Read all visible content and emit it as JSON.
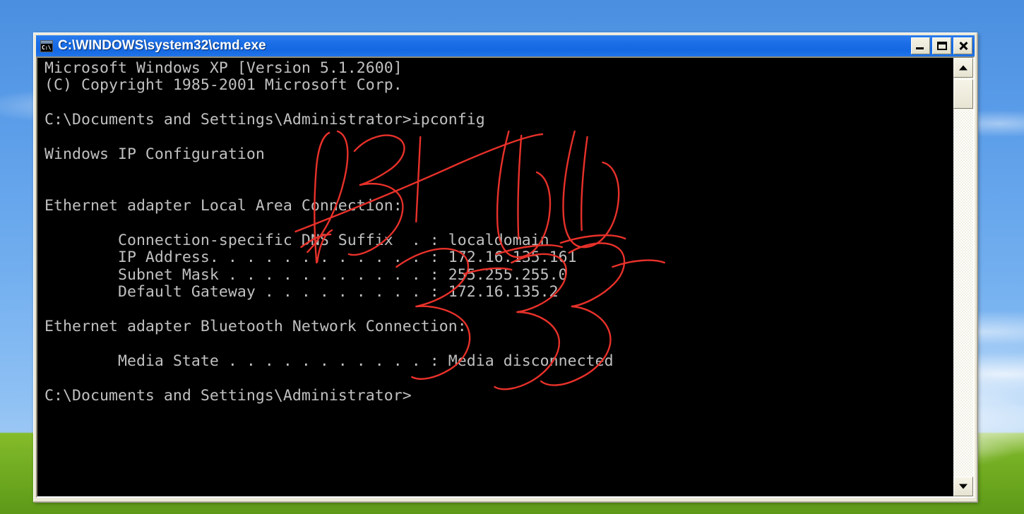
{
  "desktop": {
    "wallpaper_name": "bliss-wallpaper",
    "sky_color": "#5a9ce8",
    "grass_color": "#7cb527"
  },
  "window": {
    "title": "C:\\WINDOWS\\system32\\cmd.exe",
    "icon_name": "cmd-icon",
    "icon_glyph": "C:\\",
    "titlebar_color": "#1b6ee6",
    "buttons": {
      "minimize_label": "Minimize",
      "maximize_label": "Maximize",
      "close_label": "Close"
    }
  },
  "console": {
    "background_color": "#000000",
    "text_color": "#c0c0c0",
    "lines": [
      "Microsoft Windows XP [Version 5.1.2600]",
      "(C) Copyright 1985-2001 Microsoft Corp.",
      "",
      "C:\\Documents and Settings\\Administrator>ipconfig",
      "",
      "Windows IP Configuration",
      "",
      "",
      "Ethernet adapter Local Area Connection:",
      "",
      "        Connection-specific DNS Suffix  . : localdomain",
      "        IP Address. . . . . . . . . . . . : 172.16.135.161",
      "        Subnet Mask . . . . . . . . . . . : 255.255.255.0",
      "        Default Gateway . . . . . . . . . : 172.16.135.2",
      "",
      "Ethernet adapter Bluetooth Network Connection:",
      "",
      "        Media State . . . . . . . . . . . : Media disconnected",
      "",
      "C:\\Documents and Settings\\Administrator>"
    ],
    "command": "ipconfig",
    "prompt": "C:\\Documents and Settings\\Administrator>",
    "network": {
      "os_banner": "Microsoft Windows XP [Version 5.1.2600]",
      "copyright": "(C) Copyright 1985-2001 Microsoft Corp.",
      "section_title": "Windows IP Configuration",
      "adapters": [
        {
          "name": "Ethernet adapter Local Area Connection:",
          "fields": [
            {
              "label": "Connection-specific DNS Suffix",
              "value": "localdomain"
            },
            {
              "label": "IP Address",
              "value": "172.16.135.161"
            },
            {
              "label": "Subnet Mask",
              "value": "255.255.255.0"
            },
            {
              "label": "Default Gateway",
              "value": "172.16.135.2"
            }
          ]
        },
        {
          "name": "Ethernet adapter Bluetooth Network Connection:",
          "fields": [
            {
              "label": "Media State",
              "value": "Media disconnected"
            }
          ]
        }
      ]
    }
  },
  "annotation": {
    "name": "red-handwriting-scribble",
    "color": "#e8312a",
    "description": "red handwritten scribble drawn over the console output"
  },
  "scrollbar": {
    "up_arrow": "scroll-up-arrow",
    "down_arrow": "scroll-down-arrow",
    "thumb": "scroll-thumb"
  }
}
